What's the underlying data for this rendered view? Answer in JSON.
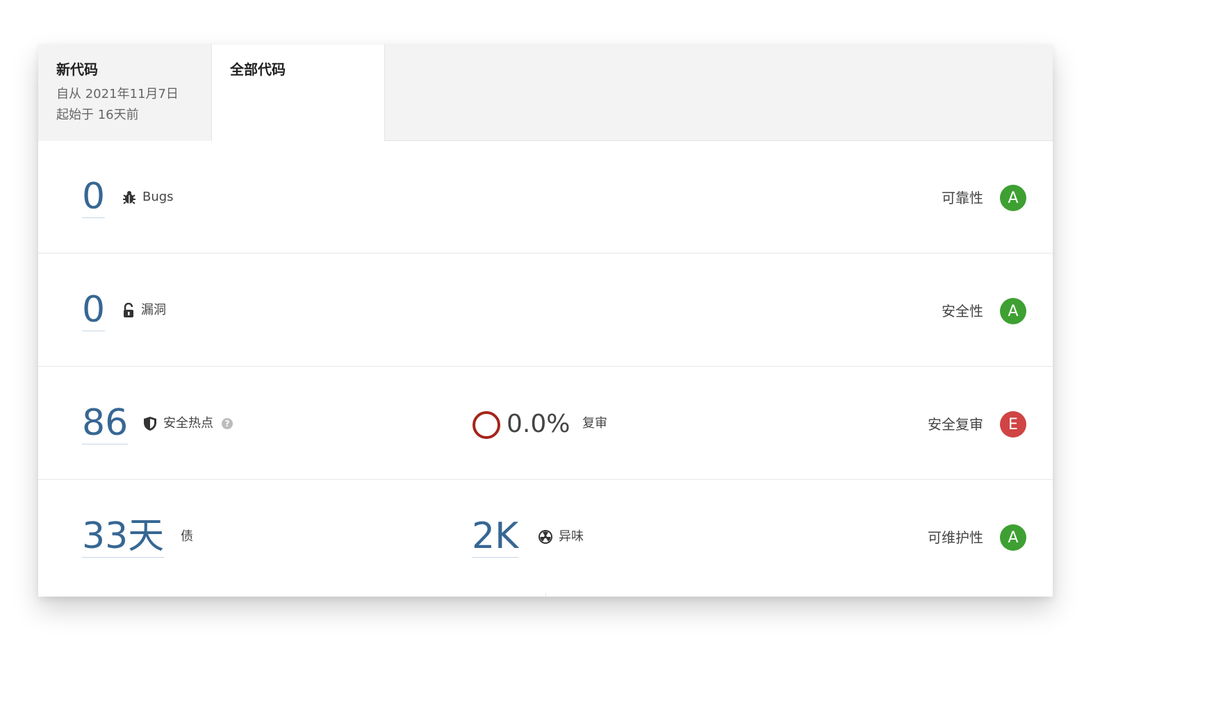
{
  "tabs": [
    {
      "title": "新代码",
      "line1": "自从 2021年11月7日",
      "line2": "起始于 16天前"
    },
    {
      "title": "全部代码"
    }
  ],
  "rows": {
    "bugs": {
      "value": "0",
      "label": "Bugs",
      "rating_label": "可靠性",
      "rating": "A",
      "icon": "bug-icon"
    },
    "vulnerabilities": {
      "value": "0",
      "label": "漏洞",
      "rating_label": "安全性",
      "rating": "A",
      "icon": "unlock-icon"
    },
    "hotspots": {
      "value": "86",
      "label": "安全热点",
      "help": "?",
      "reviewed_pct": "0.0%",
      "reviewed_label": "复审",
      "rating_label": "安全复审",
      "rating": "E",
      "icon": "shield-icon"
    },
    "debt": {
      "value": "33天",
      "label": "债",
      "smells_value": "2K",
      "smells_label": "异味",
      "rating_label": "可维护性",
      "rating": "A",
      "icon": "radiation-icon"
    }
  },
  "colors": {
    "rating_A": "#3ea032",
    "rating_E": "#d04444",
    "link_blue": "#376793",
    "ring_red": "#a4251b"
  }
}
